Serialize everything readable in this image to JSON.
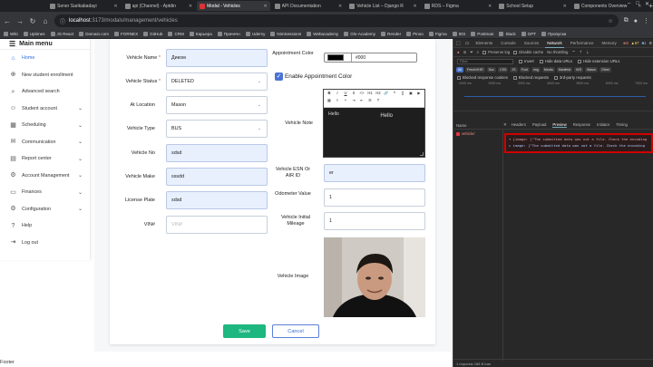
{
  "browser": {
    "tabs": [
      {
        "title": "Sener Sarikabadayi"
      },
      {
        "title": "api (Channel) - Aptdin"
      },
      {
        "title": "Modal - Vehicles"
      },
      {
        "title": "API Documentation"
      },
      {
        "title": "Vehicle List – Django R"
      },
      {
        "title": "RDS – Figma"
      },
      {
        "title": "School Setup"
      },
      {
        "title": "Components Overview"
      }
    ],
    "url_host": "localhost",
    "url_path": ":3173/modals/management/vehicles",
    "bookmarks": [
      "Wiki",
      "Uptimes",
      "JS React",
      "Domain.com",
      "FORNEX",
      "GitHub",
      "CRM",
      "Карьера",
      "Прачечн",
      "Udemy",
      "NimSessions",
      "Webacademy",
      "Glo-Academy",
      "Render",
      "Pinoo",
      "Figma",
      "IDS",
      "Postman",
      "Slack",
      "GPT",
      "Пропуски"
    ]
  },
  "sidebar": {
    "title": "Main menu",
    "items": [
      {
        "label": "Home",
        "icon": "home-icon",
        "chevron": false
      },
      {
        "label": "New student enrollment",
        "icon": "user-plus-icon",
        "chevron": false
      },
      {
        "label": "Advanced search",
        "icon": "search-icon",
        "chevron": false
      },
      {
        "label": "Student account",
        "icon": "user-icon",
        "chevron": true
      },
      {
        "label": "Scheduling",
        "icon": "calendar-icon",
        "chevron": true
      },
      {
        "label": "Communication",
        "icon": "chat-icon",
        "chevron": true
      },
      {
        "label": "Report center",
        "icon": "chart-icon",
        "chevron": true
      },
      {
        "label": "Account Management",
        "icon": "gear-icon",
        "chevron": true
      },
      {
        "label": "Finances",
        "icon": "wallet-icon",
        "chevron": true
      },
      {
        "label": "Configuration",
        "icon": "settings-icon",
        "chevron": true
      },
      {
        "label": "Help",
        "icon": "help-icon",
        "chevron": false
      },
      {
        "label": "Log out",
        "icon": "logout-icon",
        "chevron": false
      }
    ]
  },
  "footer": {
    "text": "Footer"
  },
  "form": {
    "vehicle_name_label": "Vehicle Name",
    "vehicle_name_value": "Диком",
    "vehicle_status_label": "Vehicle Status",
    "vehicle_status_value": "DELETED",
    "at_location_label": "At Location",
    "at_location_value": "Mason",
    "vehicle_type_label": "Vehicle Type",
    "vehicle_type_value": "BUS",
    "vehicle_no_label": "Vehicle No",
    "vehicle_no_value": "sdsd",
    "vehicle_make_label": "Vehicle Make",
    "vehicle_make_value": "sssdd",
    "license_plate_label": "License Plate",
    "license_plate_value": "sdsd",
    "vin_label": "VIN#",
    "vin_placeholder": "VIN#",
    "appointment_color_label": "Appointment Color",
    "appointment_color_value": "#000",
    "appointment_color_hex": "#000000",
    "enable_appointment_color_label": "Enable Appointment Color",
    "enable_appointment_color_checked": true,
    "vehicle_note_label": "Vehicle Note",
    "vehicle_note_value": "Hello",
    "vehicle_note_preview": "Hello",
    "vehicle_esn_label": "Vehicle ESN Or AIR ID",
    "vehicle_esn_value": "er",
    "odometer_label": "Odometer Value",
    "odometer_value": "1",
    "initial_mileage_label": "Vehicle Initial Mileage",
    "initial_mileage_value": "1",
    "vehicle_image_label": "Vehicle Image",
    "save_label": "Save",
    "cancel_label": "Cancel",
    "required_mark": "*"
  },
  "devtools": {
    "tabs": [
      "Elements",
      "Console",
      "Sources",
      "Network",
      "Performance",
      "Memory"
    ],
    "active_tab": "Network",
    "error_count": "8",
    "warning_count": "67",
    "info_count": "1",
    "preserve_log": "Preserve log",
    "disable_cache": "Disable cache",
    "throttle": "No throttling",
    "filter_placeholder": "Filter",
    "invert": "Invert",
    "hide_data_urls": "Hide data URLs",
    "hide_ext_urls": "Hide extension URLs",
    "type_filters": [
      "All",
      "Fetch/XHR",
      "Doc",
      "CSS",
      "JS",
      "Font",
      "Img",
      "Media",
      "Manifest",
      "WS",
      "Wasm",
      "Other"
    ],
    "blocked_cookies": "Blocked response cookies",
    "blocked_requests": "Blocked requests",
    "third_party": "3rd-party requests",
    "timeline_ticks": [
      "1000 ms",
      "2000 ms",
      "3000 ms",
      "4000 ms",
      "5000 ms",
      "6000 ms",
      "7000 ms"
    ],
    "name_col": "Name",
    "detail_tabs": [
      "Headers",
      "Payload",
      "Preview",
      "Response",
      "Initiator",
      "Timing"
    ],
    "active_detail_tab": "Preview",
    "request_name": "vehicle/",
    "preview_line1": "▾ {image: [\"The submitted data was not a file. Check the encoding",
    "preview_line2": "  ▸ image: [\"The submitted data was not a file. Check the encoding",
    "status_bar": "1 requests    188 B tran"
  }
}
